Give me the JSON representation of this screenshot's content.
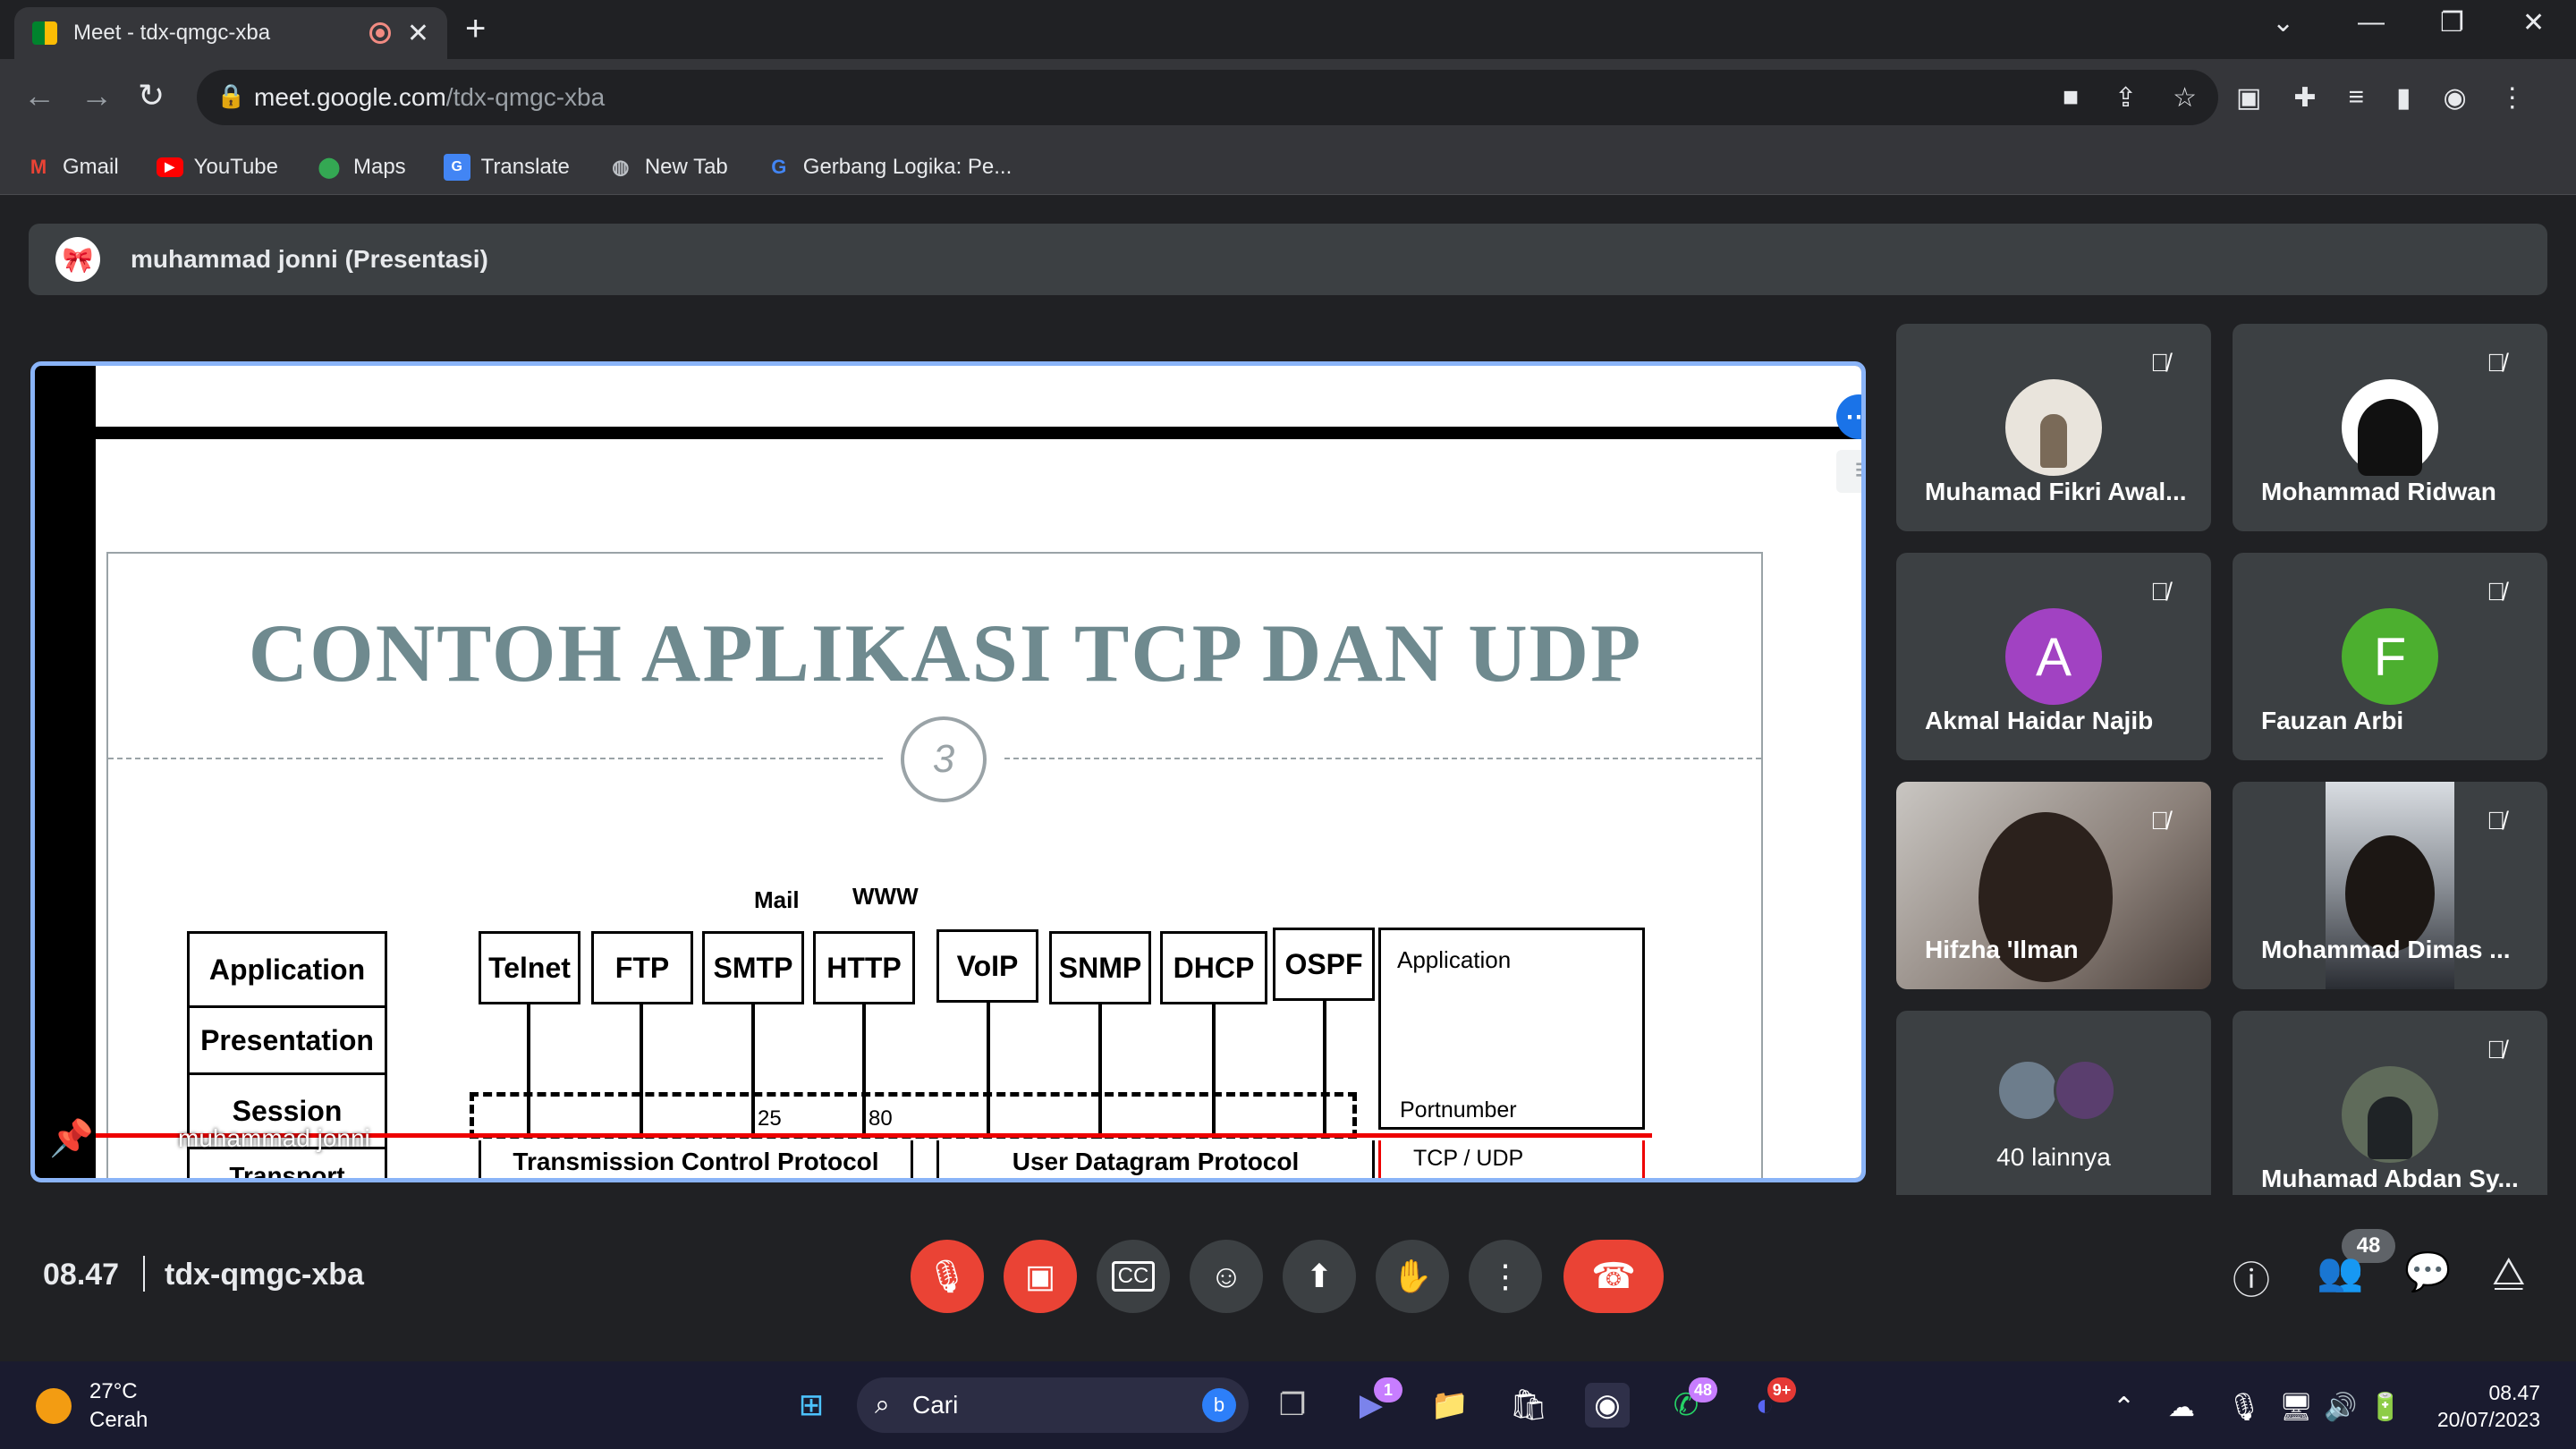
{
  "browser": {
    "tab_title": "Meet - tdx-qmgc-xba",
    "url_host": "meet.google.com",
    "url_path": "/tdx-qmgc-xba",
    "bookmarks": [
      "Gmail",
      "YouTube",
      "Maps",
      "Translate",
      "New Tab",
      "Gerbang Logika: Pe..."
    ]
  },
  "presentation": {
    "banner": "muhammad jonni (Presentasi)",
    "presenter_tag": "muhammad jonni"
  },
  "slide": {
    "title": "CONTOH APLIKASI TCP DAN UDP",
    "number": "3",
    "label_mail": "Mail",
    "label_www": "WWW",
    "layers": [
      "Application",
      "Presentation",
      "Session"
    ],
    "transport_partial": "Transport",
    "apps": [
      "Telnet",
      "FTP",
      "SMTP",
      "HTTP",
      "VoIP",
      "SNMP",
      "DHCP",
      "OSPF"
    ],
    "port_25": "25",
    "port_80": "80",
    "right_app": "Application",
    "portnumber": "Portnumber",
    "tcp": "Transmission Control Protocol",
    "udp": "User Datagram Protocol",
    "tcpudp": "TCP / UDP"
  },
  "participants": [
    {
      "name": "Muhamad Fikri Awal...",
      "type": "photo"
    },
    {
      "name": "Mohammad Ridwan",
      "type": "photo"
    },
    {
      "name": "Akmal Haidar Najib",
      "initial": "A",
      "color": "#a142c2"
    },
    {
      "name": "Fauzan Arbi",
      "initial": "F",
      "color": "#4caf2f"
    },
    {
      "name": "Hifzha 'Ilman",
      "type": "video"
    },
    {
      "name": "Mohammad Dimas ...",
      "type": "video"
    },
    {
      "name": "40 lainnya",
      "type": "others"
    },
    {
      "name": "Muhamad Abdan Sy...",
      "type": "photo"
    }
  ],
  "meeting": {
    "time": "08.47",
    "code": "tdx-qmgc-xba",
    "people_count": "48"
  },
  "taskbar": {
    "temp": "27°C",
    "condition": "Cerah",
    "search": "Cari",
    "teams_badge": "1",
    "whatsapp_badge": "48",
    "discord_badge": "9+",
    "time": "08.47",
    "date": "20/07/2023"
  },
  "colors": {
    "accent": "#8ab4f8",
    "danger": "#ea4335",
    "tile": "#3c4043"
  }
}
